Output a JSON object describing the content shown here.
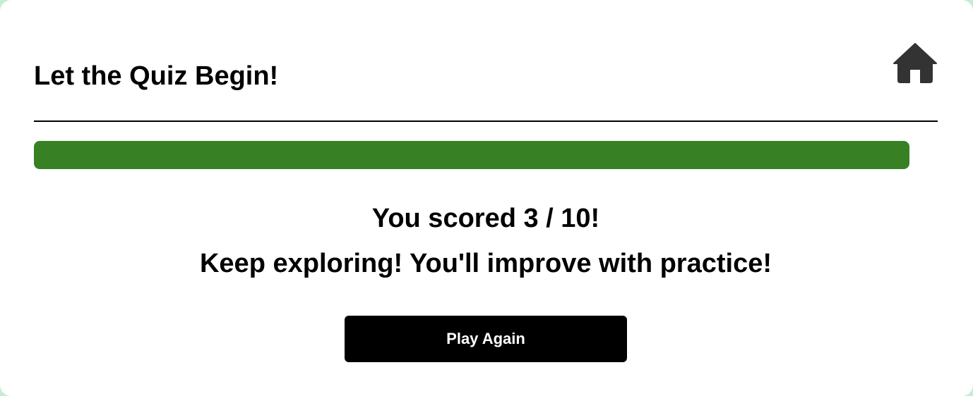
{
  "header": {
    "title": "Let the Quiz Begin!",
    "home_icon": "house-icon"
  },
  "progress": {
    "fraction": 1.0,
    "fill_color": "#388024"
  },
  "result": {
    "score_text": "You scored 3 / 10!",
    "message": "Keep exploring! You'll improve with practice!"
  },
  "actions": {
    "play_again_label": "Play Again"
  }
}
